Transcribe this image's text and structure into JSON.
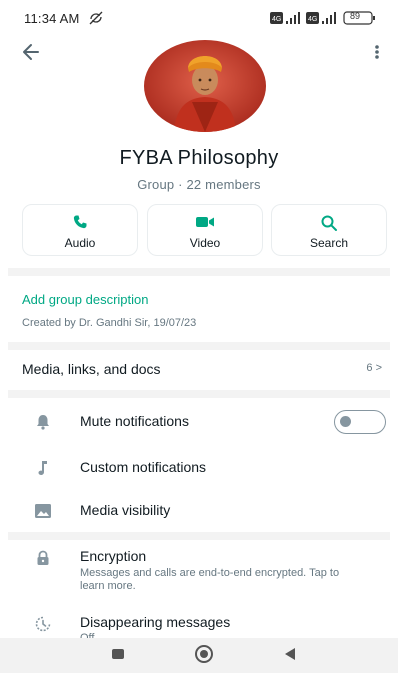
{
  "status_bar": {
    "time": "11:34 AM",
    "battery": "89"
  },
  "header": {
    "back_icon": "arrow-left-icon",
    "more_icon": "more-vertical-icon"
  },
  "group": {
    "name": "FYBA Philosophy",
    "meta": "Group · 22 members"
  },
  "actions": [
    {
      "label": "Audio",
      "icon": "phone-icon"
    },
    {
      "label": "Video",
      "icon": "video-camera-icon"
    },
    {
      "label": "Search",
      "icon": "search-icon"
    }
  ],
  "description": {
    "add_label": "Add group description",
    "created_by": "Created by Dr. Gandhi Sir, 19/07/23"
  },
  "media": {
    "label": "Media, links, and docs",
    "count": "6 >"
  },
  "settings": {
    "mute": {
      "label": "Mute notifications",
      "enabled": false
    },
    "custom": {
      "label": "Custom notifications"
    },
    "visibility": {
      "label": "Media visibility"
    },
    "encryption": {
      "label": "Encryption",
      "sub": "Messages and calls are end-to-end encrypted. Tap to learn more."
    },
    "disappearing": {
      "label": "Disappearing messages",
      "sub": "Off"
    }
  },
  "colors": {
    "accent": "#00a884",
    "icon_grey": "#8696a0",
    "text_secondary": "#667781"
  },
  "nav_bar": {
    "icons": [
      "square-icon",
      "circle-home-icon",
      "triangle-back-icon"
    ]
  }
}
